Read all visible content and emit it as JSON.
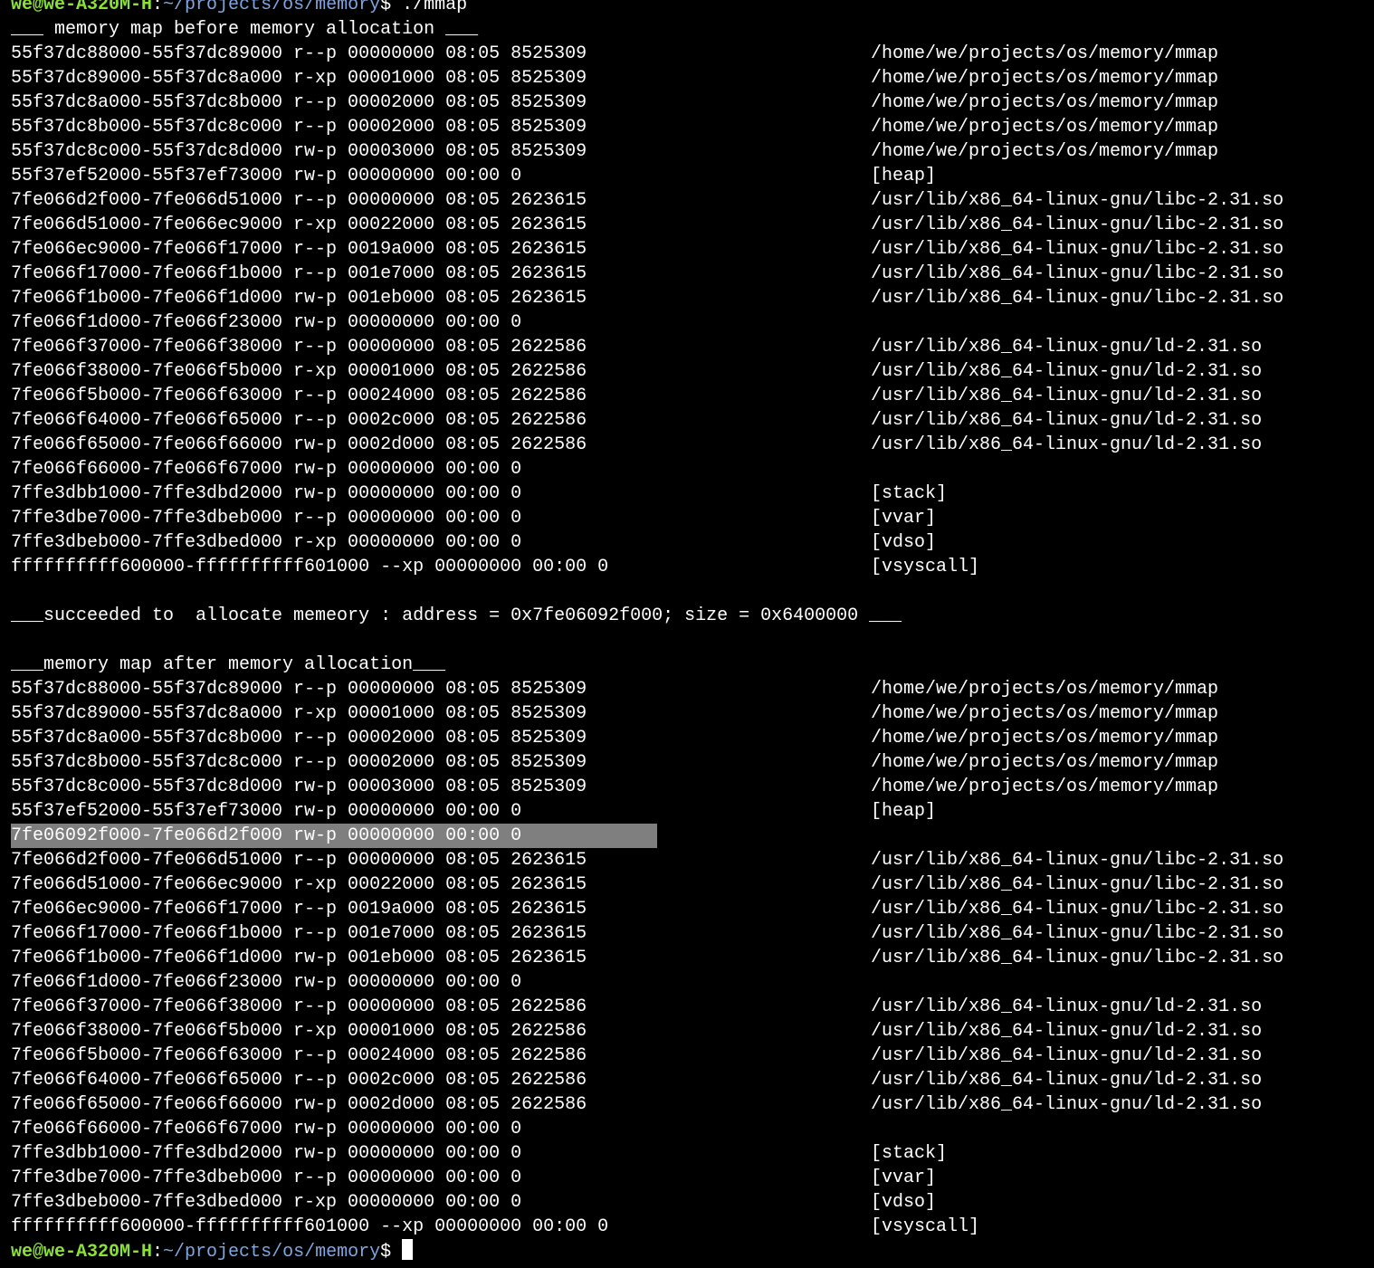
{
  "prompt": {
    "user_host": "we@we-A320M-H",
    "separator": ":",
    "cwd": "~/projects/os/memory",
    "symbol": "$"
  },
  "command": " ./mmap",
  "before_title": "___ memory map before memory allocation ___",
  "map_before": [
    {
      "text": "55f37dc88000-55f37dc89000 r--p 00000000 08:05 8525309",
      "path": "/home/we/projects/os/memory/mmap"
    },
    {
      "text": "55f37dc89000-55f37dc8a000 r-xp 00001000 08:05 8525309",
      "path": "/home/we/projects/os/memory/mmap"
    },
    {
      "text": "55f37dc8a000-55f37dc8b000 r--p 00002000 08:05 8525309",
      "path": "/home/we/projects/os/memory/mmap"
    },
    {
      "text": "55f37dc8b000-55f37dc8c000 r--p 00002000 08:05 8525309",
      "path": "/home/we/projects/os/memory/mmap"
    },
    {
      "text": "55f37dc8c000-55f37dc8d000 rw-p 00003000 08:05 8525309",
      "path": "/home/we/projects/os/memory/mmap"
    },
    {
      "text": "55f37ef52000-55f37ef73000 rw-p 00000000 00:00 0",
      "path": "[heap]"
    },
    {
      "text": "7fe066d2f000-7fe066d51000 r--p 00000000 08:05 2623615",
      "path": "/usr/lib/x86_64-linux-gnu/libc-2.31.so"
    },
    {
      "text": "7fe066d51000-7fe066ec9000 r-xp 00022000 08:05 2623615",
      "path": "/usr/lib/x86_64-linux-gnu/libc-2.31.so"
    },
    {
      "text": "7fe066ec9000-7fe066f17000 r--p 0019a000 08:05 2623615",
      "path": "/usr/lib/x86_64-linux-gnu/libc-2.31.so"
    },
    {
      "text": "7fe066f17000-7fe066f1b000 r--p 001e7000 08:05 2623615",
      "path": "/usr/lib/x86_64-linux-gnu/libc-2.31.so"
    },
    {
      "text": "7fe066f1b000-7fe066f1d000 rw-p 001eb000 08:05 2623615",
      "path": "/usr/lib/x86_64-linux-gnu/libc-2.31.so"
    },
    {
      "text": "7fe066f1d000-7fe066f23000 rw-p 00000000 00:00 0",
      "path": ""
    },
    {
      "text": "7fe066f37000-7fe066f38000 r--p 00000000 08:05 2622586",
      "path": "/usr/lib/x86_64-linux-gnu/ld-2.31.so"
    },
    {
      "text": "7fe066f38000-7fe066f5b000 r-xp 00001000 08:05 2622586",
      "path": "/usr/lib/x86_64-linux-gnu/ld-2.31.so"
    },
    {
      "text": "7fe066f5b000-7fe066f63000 r--p 00024000 08:05 2622586",
      "path": "/usr/lib/x86_64-linux-gnu/ld-2.31.so"
    },
    {
      "text": "7fe066f64000-7fe066f65000 r--p 0002c000 08:05 2622586",
      "path": "/usr/lib/x86_64-linux-gnu/ld-2.31.so"
    },
    {
      "text": "7fe066f65000-7fe066f66000 rw-p 0002d000 08:05 2622586",
      "path": "/usr/lib/x86_64-linux-gnu/ld-2.31.so"
    },
    {
      "text": "7fe066f66000-7fe066f67000 rw-p 00000000 00:00 0",
      "path": ""
    },
    {
      "text": "7ffe3dbb1000-7ffe3dbd2000 rw-p 00000000 00:00 0",
      "path": "[stack]"
    },
    {
      "text": "7ffe3dbe7000-7ffe3dbeb000 r--p 00000000 00:00 0",
      "path": "[vvar]"
    },
    {
      "text": "7ffe3dbeb000-7ffe3dbed000 r-xp 00000000 00:00 0",
      "path": "[vdso]"
    },
    {
      "text": "ffffffffff600000-ffffffffff601000 --xp 00000000 00:00 0",
      "path": "[vsyscall]"
    }
  ],
  "success_message": "___succeeded to  allocate memeory : address = 0x7fe06092f000; size = 0x6400000 ___",
  "after_title": "___memory map after memory allocation___",
  "map_after": [
    {
      "text": "55f37dc88000-55f37dc89000 r--p 00000000 08:05 8525309",
      "path": "/home/we/projects/os/memory/mmap"
    },
    {
      "text": "55f37dc89000-55f37dc8a000 r-xp 00001000 08:05 8525309",
      "path": "/home/we/projects/os/memory/mmap"
    },
    {
      "text": "55f37dc8a000-55f37dc8b000 r--p 00002000 08:05 8525309",
      "path": "/home/we/projects/os/memory/mmap"
    },
    {
      "text": "55f37dc8b000-55f37dc8c000 r--p 00002000 08:05 8525309",
      "path": "/home/we/projects/os/memory/mmap"
    },
    {
      "text": "55f37dc8c000-55f37dc8d000 rw-p 00003000 08:05 8525309",
      "path": "/home/we/projects/os/memory/mmap"
    },
    {
      "text": "55f37ef52000-55f37ef73000 rw-p 00000000 00:00 0",
      "path": "[heap]"
    },
    {
      "text": "7fe06092f000-7fe066d2f000 rw-p 00000000 00:00 0",
      "path": "",
      "highlighted": true
    },
    {
      "text": "7fe066d2f000-7fe066d51000 r--p 00000000 08:05 2623615",
      "path": "/usr/lib/x86_64-linux-gnu/libc-2.31.so"
    },
    {
      "text": "7fe066d51000-7fe066ec9000 r-xp 00022000 08:05 2623615",
      "path": "/usr/lib/x86_64-linux-gnu/libc-2.31.so"
    },
    {
      "text": "7fe066ec9000-7fe066f17000 r--p 0019a000 08:05 2623615",
      "path": "/usr/lib/x86_64-linux-gnu/libc-2.31.so"
    },
    {
      "text": "7fe066f17000-7fe066f1b000 r--p 001e7000 08:05 2623615",
      "path": "/usr/lib/x86_64-linux-gnu/libc-2.31.so"
    },
    {
      "text": "7fe066f1b000-7fe066f1d000 rw-p 001eb000 08:05 2623615",
      "path": "/usr/lib/x86_64-linux-gnu/libc-2.31.so"
    },
    {
      "text": "7fe066f1d000-7fe066f23000 rw-p 00000000 00:00 0",
      "path": ""
    },
    {
      "text": "7fe066f37000-7fe066f38000 r--p 00000000 08:05 2622586",
      "path": "/usr/lib/x86_64-linux-gnu/ld-2.31.so"
    },
    {
      "text": "7fe066f38000-7fe066f5b000 r-xp 00001000 08:05 2622586",
      "path": "/usr/lib/x86_64-linux-gnu/ld-2.31.so"
    },
    {
      "text": "7fe066f5b000-7fe066f63000 r--p 00024000 08:05 2622586",
      "path": "/usr/lib/x86_64-linux-gnu/ld-2.31.so"
    },
    {
      "text": "7fe066f64000-7fe066f65000 r--p 0002c000 08:05 2622586",
      "path": "/usr/lib/x86_64-linux-gnu/ld-2.31.so"
    },
    {
      "text": "7fe066f65000-7fe066f66000 rw-p 0002d000 08:05 2622586",
      "path": "/usr/lib/x86_64-linux-gnu/ld-2.31.so"
    },
    {
      "text": "7fe066f66000-7fe066f67000 rw-p 00000000 00:00 0",
      "path": ""
    },
    {
      "text": "7ffe3dbb1000-7ffe3dbd2000 rw-p 00000000 00:00 0",
      "path": "[stack]"
    },
    {
      "text": "7ffe3dbe7000-7ffe3dbeb000 r--p 00000000 00:00 0",
      "path": "[vvar]"
    },
    {
      "text": "7ffe3dbeb000-7ffe3dbed000 r-xp 00000000 00:00 0",
      "path": "[vdso]"
    },
    {
      "text": "ffffffffff600000-ffffffffff601000 --xp 00000000 00:00 0",
      "path": "[vsyscall]"
    }
  ],
  "colors": {
    "background": "#000000",
    "text": "#ffffff",
    "prompt_user": "#8ae234",
    "prompt_path": "#7fa6e0",
    "highlight": "#7f7f7f"
  }
}
